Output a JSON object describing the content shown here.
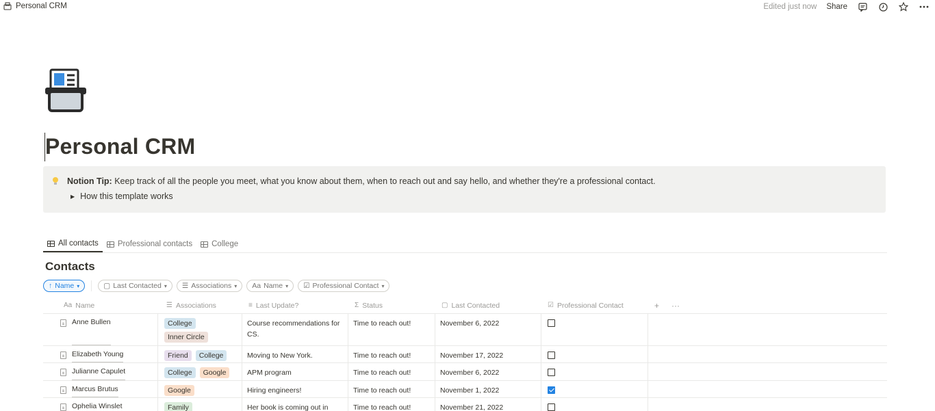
{
  "topbar": {
    "breadcrumb": "Personal CRM",
    "edited": "Edited just now",
    "share": "Share"
  },
  "page": {
    "title": "Personal CRM",
    "callout_label": "Notion Tip:",
    "callout_text": " Keep track of all the people you meet, what you know about them, when to reach out and say hello, and whether they're a professional contact.",
    "toggle_label": "How this template works"
  },
  "views": {
    "tabs": [
      {
        "label": "All contacts"
      },
      {
        "label": "Professional contacts"
      },
      {
        "label": "College"
      }
    ]
  },
  "database": {
    "title": "Contacts",
    "filters": {
      "sort": "Name",
      "last_contacted": "Last Contacted",
      "associations": "Associations",
      "name": "Name",
      "professional": "Professional Contact"
    },
    "columns": {
      "name": "Name",
      "associations": "Associations",
      "last_update": "Last Update?",
      "status": "Status",
      "last_contacted": "Last Contacted",
      "professional": "Professional Contact"
    },
    "rows": [
      {
        "name": "Anne Bullen",
        "tags": [
          "College",
          "Inner Circle"
        ],
        "update": "Course recommendations for CS.",
        "status": "Time to reach out!",
        "date": "November 6, 2022",
        "professional": false
      },
      {
        "name": "Elizabeth Young",
        "tags": [
          "Friend",
          "College"
        ],
        "update": "Moving to New York.",
        "status": "Time to reach out!",
        "date": "November 17, 2022",
        "professional": false
      },
      {
        "name": "Julianne Capulet",
        "tags": [
          "College",
          "Google"
        ],
        "update": "APM program",
        "status": "Time to reach out!",
        "date": "November 6, 2022",
        "professional": false
      },
      {
        "name": "Marcus Brutus",
        "tags": [
          "Google"
        ],
        "update": "Hiring engineers!",
        "status": "Time to reach out!",
        "date": "November 1, 2022",
        "professional": true
      },
      {
        "name": "Ophelia Winslet",
        "tags": [
          "Family"
        ],
        "update": "Her book is coming out in",
        "status": "Time to reach out!",
        "date": "November 21, 2022",
        "professional": false
      }
    ]
  },
  "colors": {
    "accent": "#2383e2",
    "text": "#37352f",
    "muted": "#9b9a97",
    "callout_bg": "#f1f1ef"
  },
  "icons": {
    "breadcrumb": "card-index-icon",
    "comments": "comment-icon",
    "updates": "clock-icon",
    "favorite": "star-icon",
    "more": "more-icon"
  }
}
